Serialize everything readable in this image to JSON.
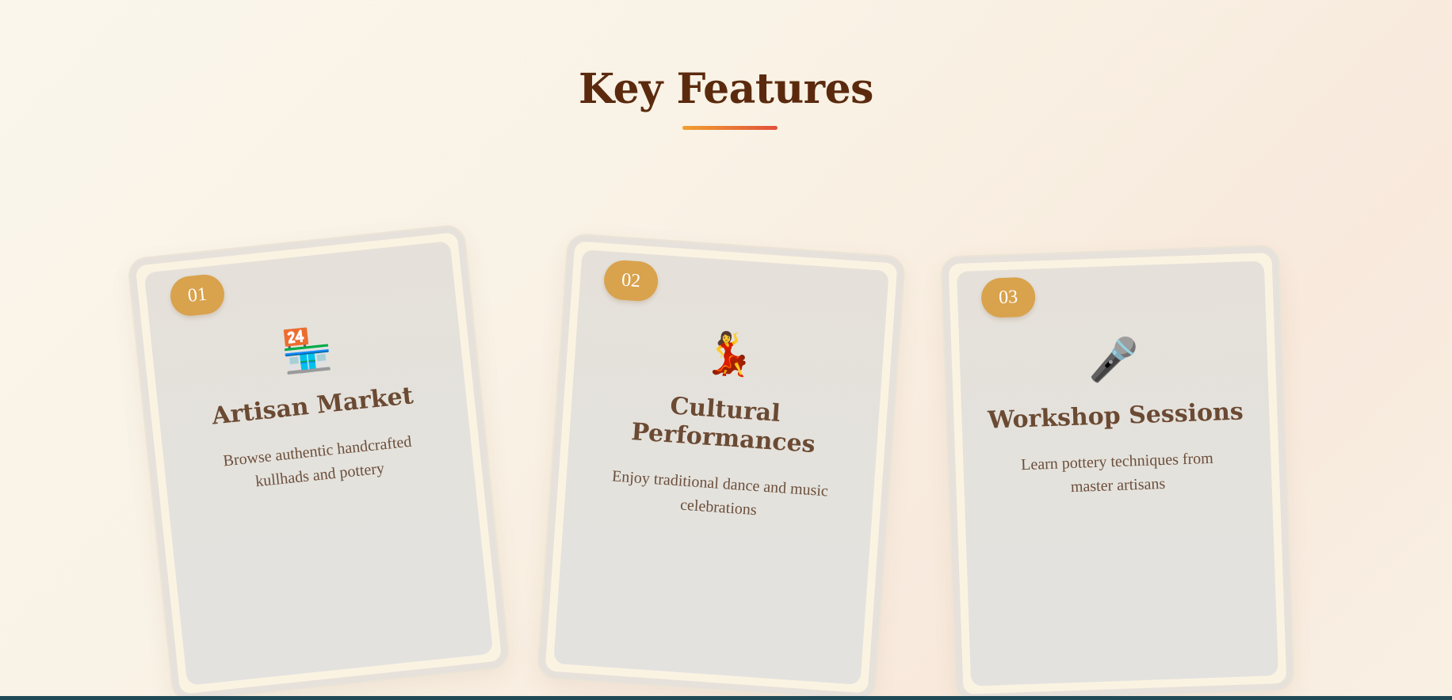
{
  "section": {
    "title": "Key Features",
    "accent_colors": [
      "#f0a030",
      "#e2503a"
    ]
  },
  "features": [
    {
      "number": "01",
      "icon": "convenience-store-icon",
      "icon_glyph": "🏪",
      "title": "Artisan Market",
      "description": "Browse authentic handcrafted kullhads and pottery"
    },
    {
      "number": "02",
      "icon": "dancer-icon",
      "icon_glyph": "💃",
      "title": "Cultural Performances",
      "description": "Enjoy traditional dance and music celebrations"
    },
    {
      "number": "03",
      "icon": "microphone-icon",
      "icon_glyph": "🎤",
      "title": "Workshop Sessions",
      "description": "Learn pottery techniques from master artisans"
    }
  ],
  "colors": {
    "title": "#5b2a0e",
    "badge": "#d9a24c",
    "card_text": "#6b4a33",
    "footer_bar": "#1f4a56"
  }
}
